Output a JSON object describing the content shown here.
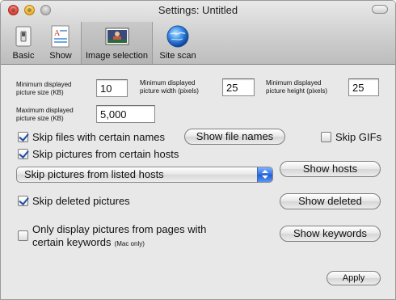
{
  "window": {
    "title": "Settings: Untitled"
  },
  "toolbar": {
    "items": [
      {
        "label": "Basic",
        "icon": "switch-icon"
      },
      {
        "label": "Show",
        "icon": "document-icon"
      },
      {
        "label": "Image selection",
        "icon": "photo-icon",
        "selected": true
      },
      {
        "label": "Site scan",
        "icon": "globe-icon"
      }
    ]
  },
  "sizes": {
    "min_picture_size_label_1": "Minimum displayed",
    "min_picture_size_label_2": "picture size (KB)",
    "min_picture_size": "10",
    "min_width_label_1": "Minimum displayed",
    "min_width_label_2": "picture width (pixels)",
    "min_width": "25",
    "min_height_label_1": "Minimum displayed",
    "min_height_label_2": "picture height (pixels)",
    "min_height": "25",
    "max_picture_size_label_1": "Maximum displayed",
    "max_picture_size_label_2": "picture size (KB)",
    "max_picture_size": "5,000"
  },
  "options": {
    "skip_names_label": "Skip files with certain names",
    "skip_names_checked": true,
    "show_file_names_button": "Show file names",
    "skip_gifs_label": "Skip GIFs",
    "skip_gifs_checked": false,
    "skip_hosts_label": "Skip pictures from certain hosts",
    "skip_hosts_checked": true,
    "hosts_mode_selected": "Skip pictures from listed hosts",
    "show_hosts_button": "Show hosts",
    "skip_deleted_label": "Skip deleted pictures",
    "skip_deleted_checked": true,
    "show_deleted_button": "Show deleted",
    "keywords_label_1": "Only display pictures from pages with",
    "keywords_label_2": "certain keywords",
    "keywords_mac_note": "(Mac only)",
    "keywords_checked": false,
    "show_keywords_button": "Show keywords"
  },
  "footer": {
    "apply_button": "Apply"
  },
  "colors": {
    "accent": "#2f6fe0",
    "window_bg": "#e8e8e8"
  }
}
